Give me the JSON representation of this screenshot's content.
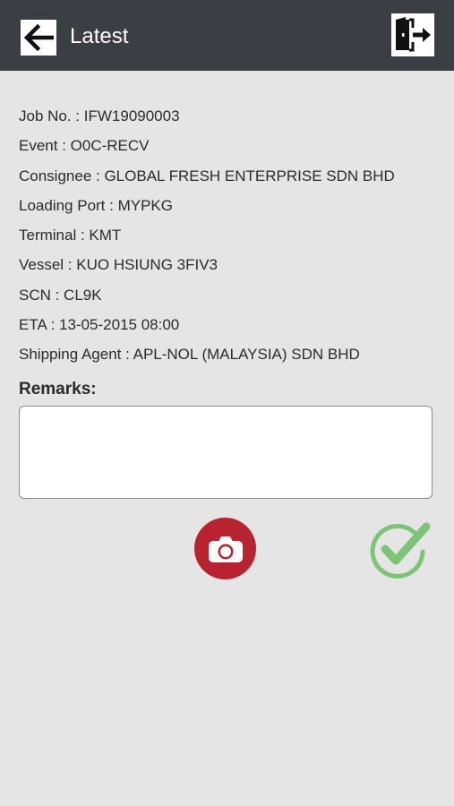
{
  "header": {
    "title": "Latest",
    "back_icon": "arrow-left-icon",
    "logout_icon": "exit-door-icon"
  },
  "job": {
    "rows": [
      "Job No. : IFW19090003",
      "Event : O0C-RECV",
      "Consignee : GLOBAL FRESH ENTERPRISE SDN BHD",
      "Loading Port : MYPKG",
      "Terminal : KMT",
      "Vessel : KUO HSIUNG 3FIV3",
      "SCN : CL9K",
      "ETA : 13-05-2015 08:00",
      "Shipping Agent : APL-NOL (MALAYSIA) SDN BHD"
    ]
  },
  "remarks": {
    "label": "Remarks:",
    "value": ""
  },
  "actions": {
    "camera_icon": "camera-icon",
    "confirm_icon": "checkmark-circle-icon"
  },
  "colors": {
    "header_bg": "#3b3f44",
    "page_bg": "#e5e5e5",
    "camera_red": "#b8232f",
    "confirm_green": "#7cc576"
  }
}
